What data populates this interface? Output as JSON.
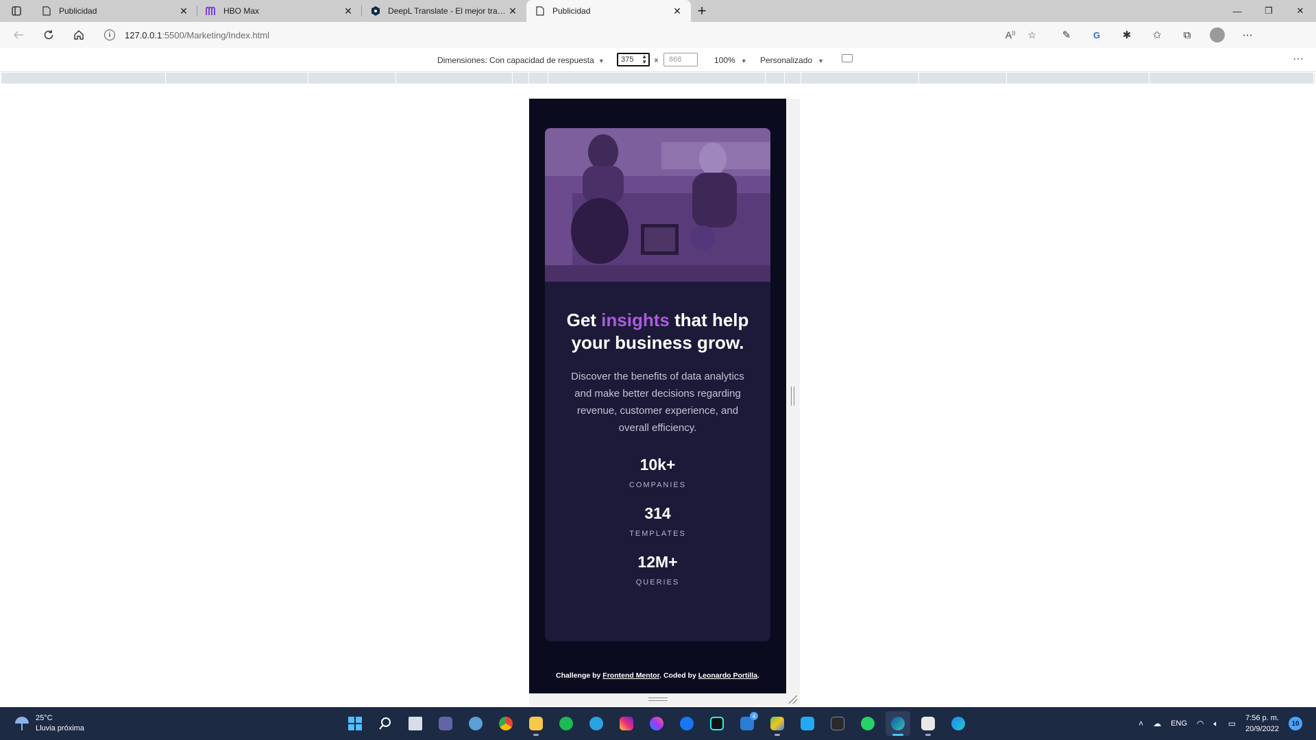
{
  "browser": {
    "tabs": [
      {
        "title": "Publicidad",
        "icon": "page-icon",
        "active": false
      },
      {
        "title": "HBO Max",
        "icon": "hbo-max-icon",
        "active": false
      },
      {
        "title": "DeepL Translate - El mejor traductor",
        "icon": "deepl-icon",
        "active": false
      },
      {
        "title": "Publicidad",
        "icon": "page-icon",
        "active": true
      }
    ],
    "url_host": "127.0.0.1",
    "url_path": ":5500/Marketing/Index.html"
  },
  "device_toolbar": {
    "dimensions_label": "Dimensiones: Con capacidad de respuesta",
    "width_value": "375",
    "times": "×",
    "height_placeholder": "868",
    "zoom": "100%",
    "throttle": "Personalizado"
  },
  "page": {
    "headline_pre": "Get ",
    "headline_accent": "insights",
    "headline_post": " that help your business grow.",
    "description": "Discover the benefits of data analytics and make better decisions regarding revenue, customer experience, and overall efficiency.",
    "stats": [
      {
        "value": "10k+",
        "label": "COMPANIES"
      },
      {
        "value": "314",
        "label": "TEMPLATES"
      },
      {
        "value": "12M+",
        "label": "QUERIES"
      }
    ],
    "attribution_pre": "Challenge by ",
    "attribution_link1": "Frontend Mentor",
    "attribution_mid": ". Coded by ",
    "attribution_link2": "Leonardo Portilla",
    "attribution_post": ".",
    "accent_color": "#ab5cdb",
    "card_color": "#1c1a38",
    "background_color": "#0b0b1f"
  },
  "taskbar": {
    "temperature": "25°C",
    "weather_text": "Lluvia próxima",
    "language": "ENG",
    "time": "7:56 p. m.",
    "date": "20/9/2022",
    "notifications": "10",
    "mail_badge": "4"
  }
}
